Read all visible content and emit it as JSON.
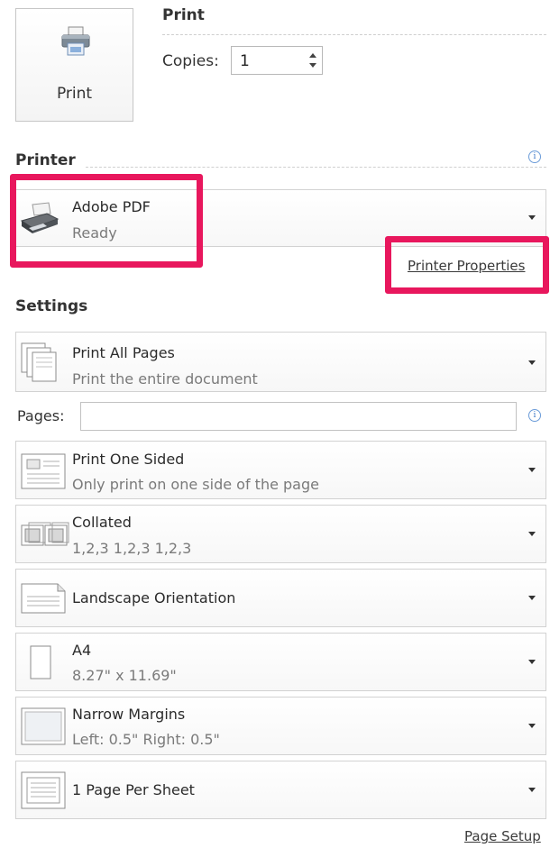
{
  "print_section": {
    "button_label": "Print",
    "heading": "Print",
    "copies_label": "Copies:",
    "copies_value": "1"
  },
  "printer": {
    "heading": "Printer",
    "name": "Adobe PDF",
    "status": "Ready",
    "properties_link": "Printer Properties"
  },
  "settings": {
    "heading": "Settings",
    "pages_label": "Pages:",
    "pages_value": "",
    "items": [
      {
        "title": "Print All Pages",
        "subtitle": "Print the entire document",
        "icon": "pages-icon"
      },
      {
        "title": "Print One Sided",
        "subtitle": "Only print on one side of the page",
        "icon": "one-sided-icon"
      },
      {
        "title": "Collated",
        "subtitle": "1,2,3   1,2,3   1,2,3",
        "icon": "collated-icon"
      },
      {
        "title": "Landscape Orientation",
        "subtitle": "",
        "icon": "landscape-icon"
      },
      {
        "title": "A4",
        "subtitle": "8.27\" x 11.69\"",
        "icon": "paper-size-icon"
      },
      {
        "title": "Narrow Margins",
        "subtitle": "Left: 0.5\"   Right: 0.5\"",
        "icon": "margins-icon"
      },
      {
        "title": "1 Page Per Sheet",
        "subtitle": "",
        "icon": "pages-per-sheet-icon"
      }
    ],
    "page_setup_link": "Page Setup"
  },
  "colors": {
    "highlight": "#e8175d",
    "info": "#3d78c8"
  }
}
